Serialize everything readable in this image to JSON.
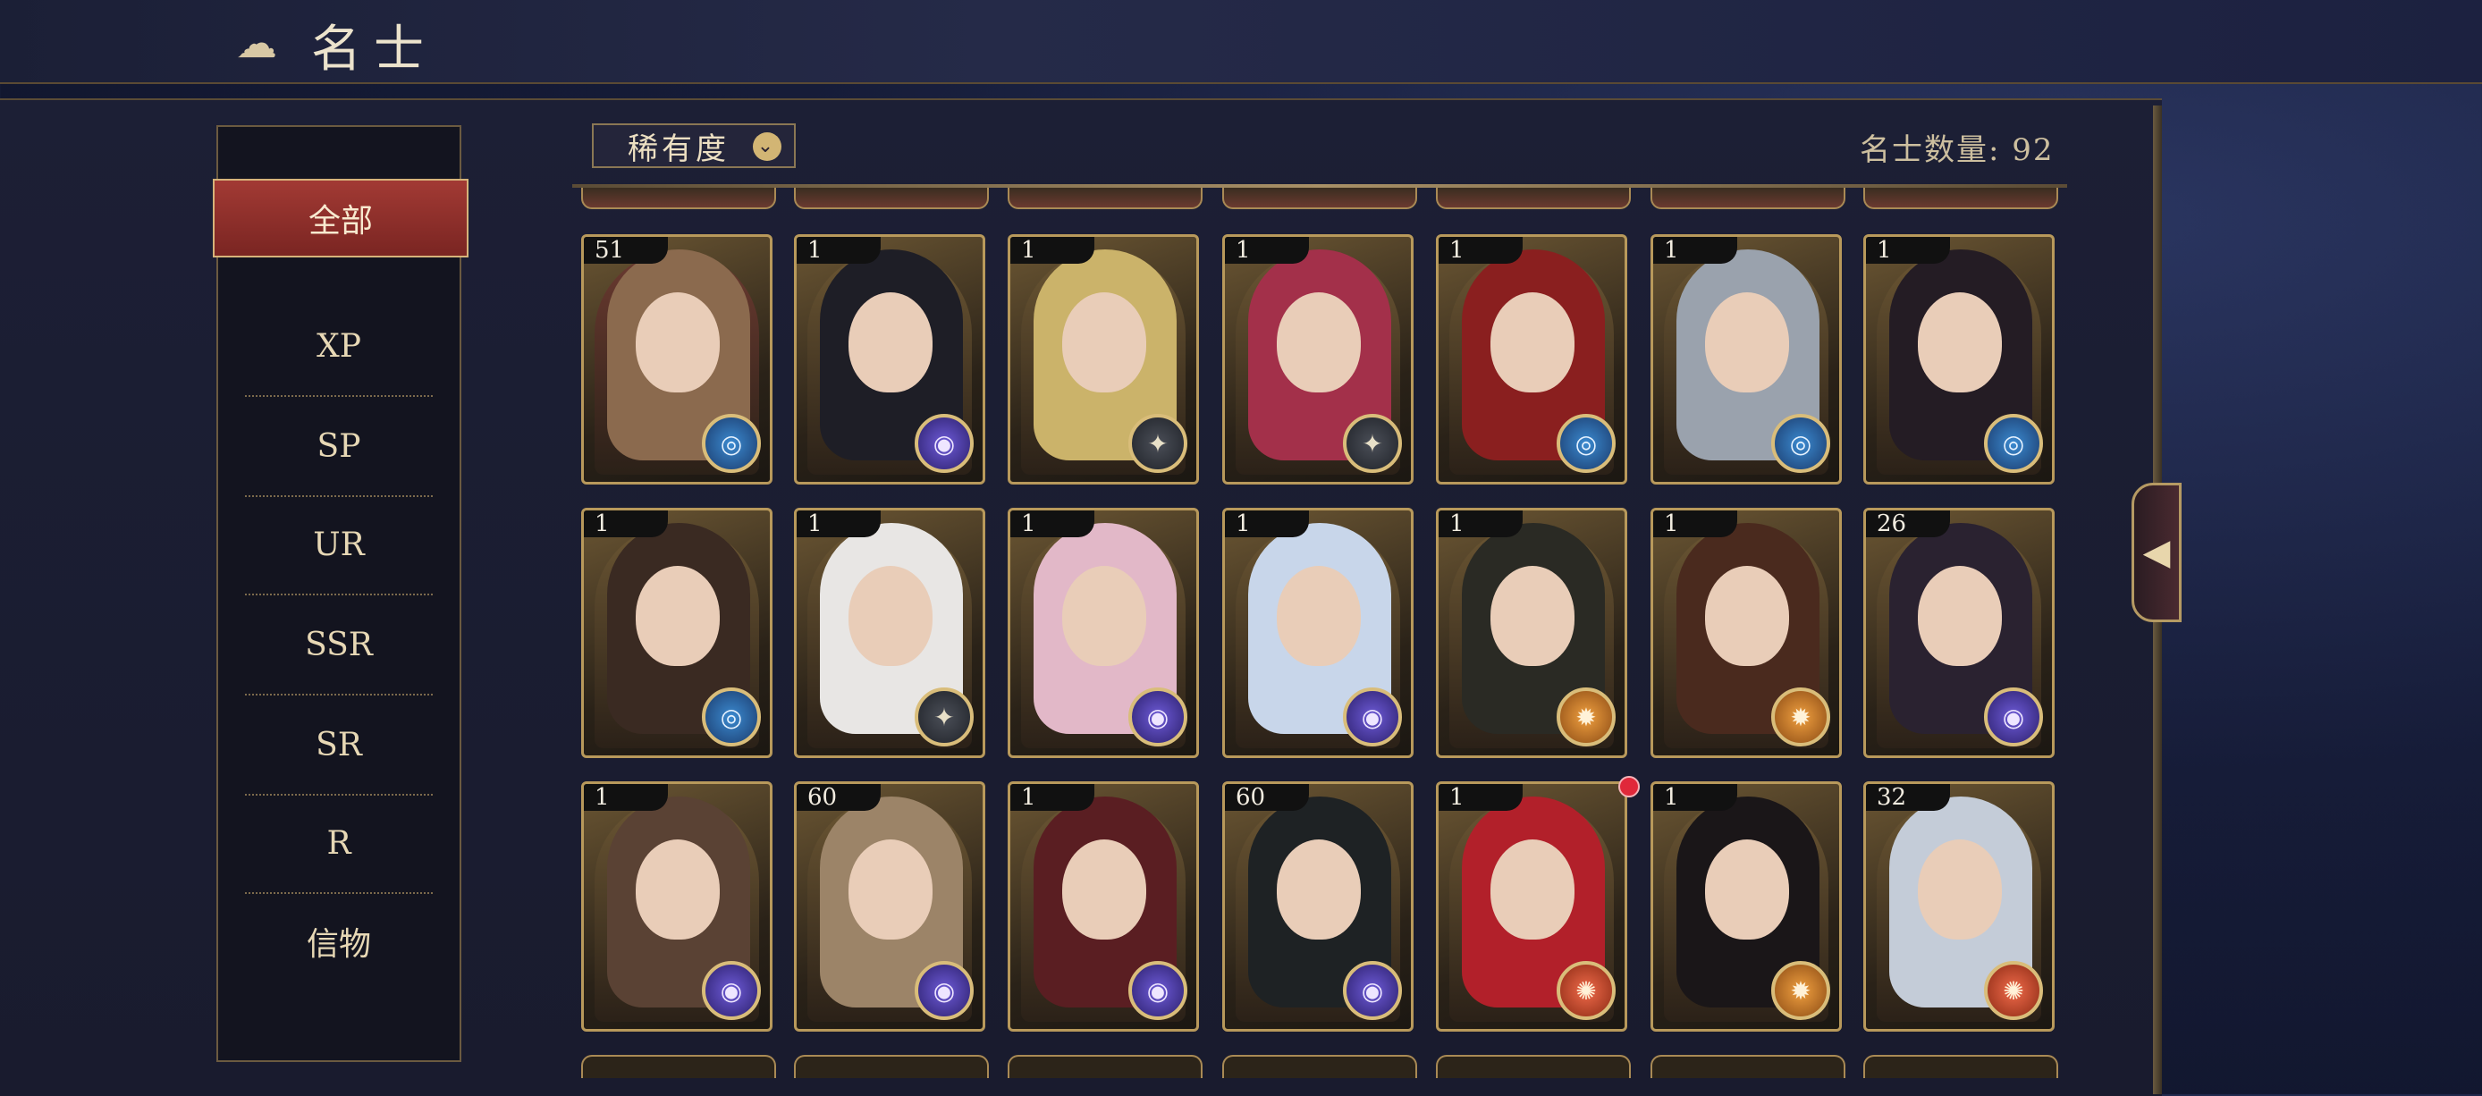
{
  "header": {
    "title": "名士"
  },
  "toolbar": {
    "sort_label": "稀有度",
    "count_text": "名士数量: 92"
  },
  "sidebar": {
    "items": [
      {
        "label": "全部",
        "active": true
      },
      {
        "label": "XP"
      },
      {
        "label": "SP"
      },
      {
        "label": "UR"
      },
      {
        "label": "SSR"
      },
      {
        "label": "SR"
      },
      {
        "label": "R"
      },
      {
        "label": "信物"
      }
    ]
  },
  "colors": {
    "accent_gold": "#b8995b",
    "active_red": "#a23a34",
    "panel_bg": "#1c1f35",
    "text_gold": "#e7d8b5"
  },
  "cards": [
    {
      "level": "51",
      "badge": "blue",
      "hair": "#8b6a4e",
      "bg": "#6b3a30"
    },
    {
      "level": "1",
      "badge": "purple",
      "hair": "#1e1e26",
      "bg": "#6b5633"
    },
    {
      "level": "1",
      "badge": "grey",
      "hair": "#cbb36a",
      "bg": "#6b5633"
    },
    {
      "level": "1",
      "badge": "grey",
      "hair": "#a3304a",
      "bg": "#6b5633"
    },
    {
      "level": "1",
      "badge": "blue",
      "hair": "#8a1f1f",
      "bg": "#6b5633"
    },
    {
      "level": "1",
      "badge": "blue",
      "hair": "#9aa2ad",
      "bg": "#6b5633"
    },
    {
      "level": "1",
      "badge": "blue",
      "hair": "#241c24",
      "bg": "#6b5633"
    },
    {
      "level": "1",
      "badge": "blue",
      "hair": "#3a2a22",
      "bg": "#6b5633"
    },
    {
      "level": "1",
      "badge": "grey",
      "hair": "#e8e6e4",
      "bg": "#6b5633"
    },
    {
      "level": "1",
      "badge": "purple",
      "hair": "#e2b8c8",
      "bg": "#6b5633"
    },
    {
      "level": "1",
      "badge": "purple",
      "hair": "#c8d6ea",
      "bg": "#6b5633"
    },
    {
      "level": "1",
      "badge": "orange",
      "hair": "#2a2a24",
      "bg": "#6b5633"
    },
    {
      "level": "1",
      "badge": "orange",
      "hair": "#4a2a1e",
      "bg": "#6b5633"
    },
    {
      "level": "26",
      "badge": "purple",
      "hair": "#2a2230",
      "bg": "#6b5633"
    },
    {
      "level": "1",
      "badge": "purple",
      "hair": "#5a4234",
      "bg": "#6b5633"
    },
    {
      "level": "60",
      "badge": "purple",
      "hair": "#9c8468",
      "bg": "#6b5633"
    },
    {
      "level": "1",
      "badge": "purple",
      "hair": "#5a1e22",
      "bg": "#6b5633"
    },
    {
      "level": "60",
      "badge": "purple",
      "hair": "#1e2224",
      "bg": "#6b5633"
    },
    {
      "level": "1",
      "badge": "red",
      "hair": "#b2202a",
      "bg": "#6b5633",
      "new": true
    },
    {
      "level": "1",
      "badge": "orange",
      "hair": "#1a1618",
      "bg": "#6b5633"
    },
    {
      "level": "32",
      "badge": "red",
      "hair": "#c4ccd8",
      "bg": "#6b5633"
    }
  ]
}
